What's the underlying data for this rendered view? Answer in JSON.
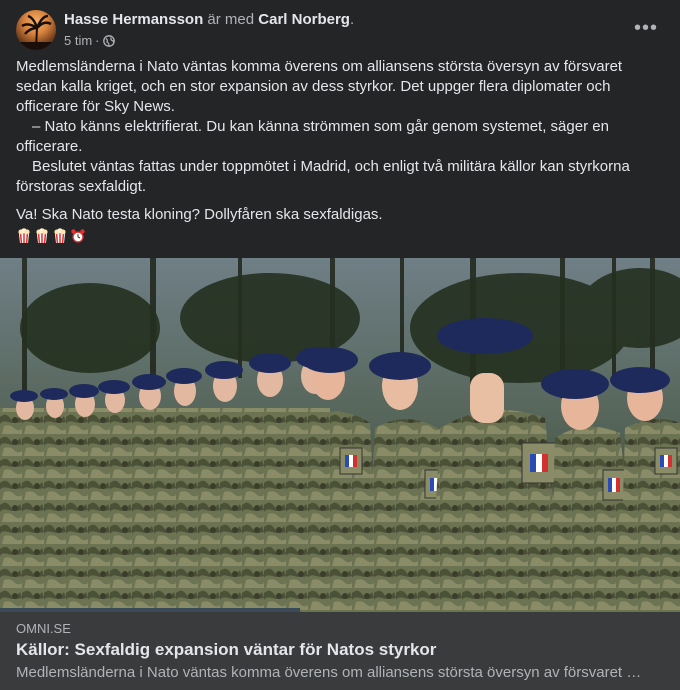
{
  "post": {
    "author": "Hasse Hermansson",
    "with_text": "är med",
    "tagged": "Carl Norberg",
    "tagged_suffix": ".",
    "time": "5 tim",
    "time_sep": "·",
    "privacy_icon": "globe-icon",
    "more_icon": "more-options-icon",
    "more_glyph": "•••",
    "paragraphs": [
      "Medlemsländerna i Nato väntas komma överens om alliansens största översyn av försvaret sedan kalla kriget, och en stor expansion av dess styrkor. Det uppger flera diplomater och officerare för Sky News.",
      "– Nato känns elektrifierat. Du kan känna strömmen som går genom systemet, säger en officerare.",
      "Beslutet väntas fattas under toppmötet i Madrid, och enligt två militära källor kan styrkorna förstoras sexfaldigt."
    ],
    "comment": "Va! Ska Nato testa kloning? Dollyfåren ska sexfaldigas.",
    "emojis": [
      "popcorn-icon",
      "popcorn-icon",
      "popcorn-icon",
      "alarm-clock-icon"
    ]
  },
  "link": {
    "domain": "OMNI.SE",
    "title": "Källor: Sexfaldig expansion väntar för Natos styrkor",
    "description": "Medlemsländerna i Nato väntas komma överens om alliansens största översyn av försvaret s…"
  },
  "colors": {
    "background": "#242526",
    "card": "#3a3b3c",
    "primary_text": "#e4e6eb",
    "secondary_text": "#b0b3b8",
    "beret": "#1f2a5c"
  }
}
